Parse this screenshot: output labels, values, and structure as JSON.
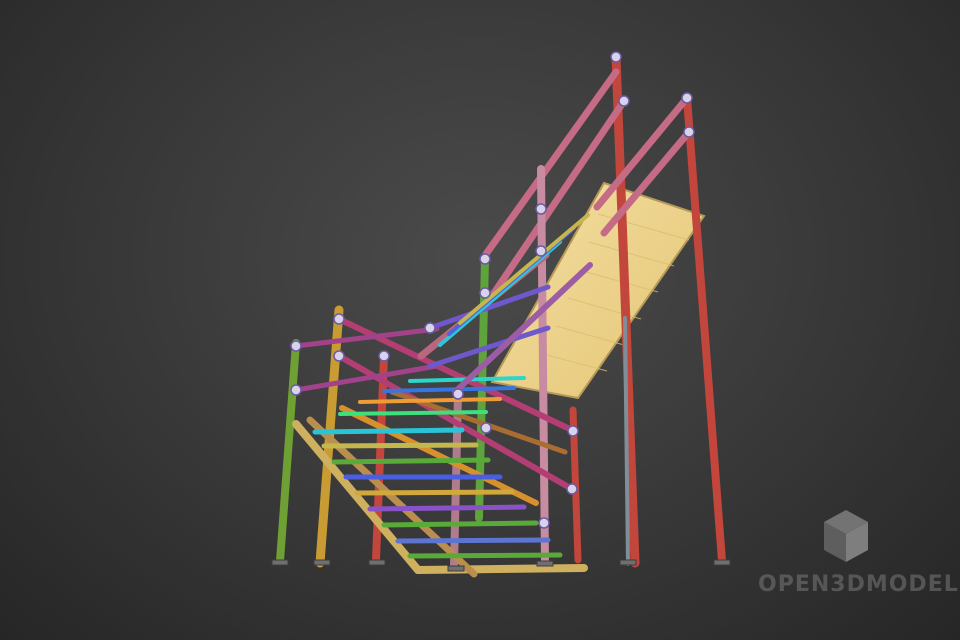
{
  "viewport": {
    "background": "#3b3b3b"
  },
  "model": {
    "colors": {
      "red_post": "#c2463b",
      "pink_post": "#c56b86",
      "yellow_post": "#c89c32",
      "green_post": "#6fa033",
      "magenta_rail": "#b43e74",
      "platform_fill": "#f0d890",
      "platform_edge": "#d8bf6d",
      "cyan": "#29c5d6",
      "blue": "#4a5fe0",
      "orange": "#d7912c",
      "purple": "#8a52c8"
    }
  },
  "watermark": {
    "text": "OPEN3DMODEL",
    "icon": "cube-logo-icon"
  }
}
